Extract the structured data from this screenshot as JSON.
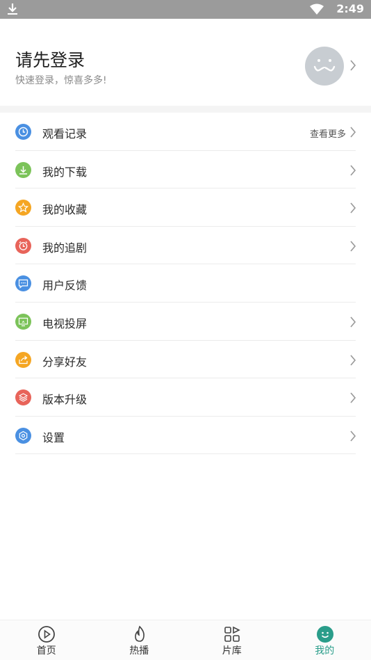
{
  "status_bar": {
    "time": "2:49"
  },
  "login": {
    "title": "请先登录",
    "subtitle": "快速登录，惊喜多多!"
  },
  "menu": [
    {
      "label": "观看记录",
      "more": "查看更多",
      "icon": "clock-icon",
      "color": "#4a90e2",
      "arrow": true
    },
    {
      "label": "我的下载",
      "more": "",
      "icon": "download-icon",
      "color": "#7cc35a",
      "arrow": true
    },
    {
      "label": "我的收藏",
      "more": "",
      "icon": "star-icon",
      "color": "#f5a623",
      "arrow": true
    },
    {
      "label": "我的追剧",
      "more": "",
      "icon": "alarm-icon",
      "color": "#e8645a",
      "arrow": true
    },
    {
      "label": "用户反馈",
      "more": "",
      "icon": "message-icon",
      "color": "#4a90e2",
      "arrow": false
    },
    {
      "label": "电视投屏",
      "more": "",
      "icon": "tv-icon",
      "color": "#7cc35a",
      "arrow": true
    },
    {
      "label": "分享好友",
      "more": "",
      "icon": "share-icon",
      "color": "#f5a623",
      "arrow": true
    },
    {
      "label": "版本升级",
      "more": "",
      "icon": "layers-icon",
      "color": "#e8645a",
      "arrow": true
    },
    {
      "label": "设置",
      "more": "",
      "icon": "gear-icon",
      "color": "#4a90e2",
      "arrow": true
    }
  ],
  "tabs": [
    {
      "label": "首页",
      "icon": "play-icon",
      "active": false
    },
    {
      "label": "热播",
      "icon": "flame-icon",
      "active": false
    },
    {
      "label": "片库",
      "icon": "grid-icon",
      "active": false
    },
    {
      "label": "我的",
      "icon": "smile-icon",
      "active": true
    }
  ],
  "colors": {
    "accent": "#2a9d8a",
    "status_bar": "#9b9b9b"
  }
}
